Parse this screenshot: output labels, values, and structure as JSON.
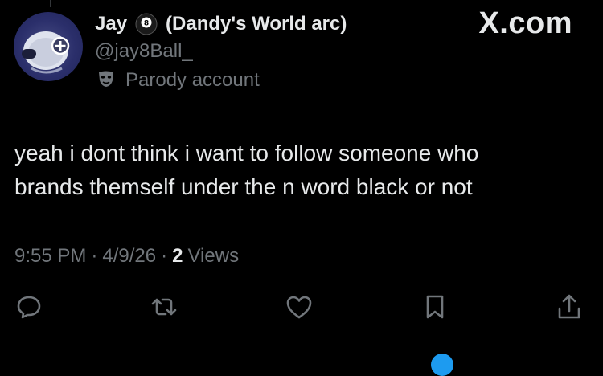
{
  "header": {
    "display_name": "Jay",
    "name_suffix": "(Dandy's World arc)",
    "handle": "@jay8Ball_",
    "parody_label": "Parody account",
    "brand": "X.com",
    "name_emoji": "8-ball-icon",
    "avatar_icon": "avatar"
  },
  "tweet": {
    "lines": [
      "yeah i dont think i want to follow someone who",
      "brands themself under the n word black or not"
    ]
  },
  "meta": {
    "time": "9:55 PM",
    "separator": "·",
    "date": "4/9/26",
    "views_count": "2",
    "views_label": "Views"
  },
  "actions": [
    {
      "icon": "reply-icon"
    },
    {
      "icon": "retweet-icon"
    },
    {
      "icon": "like-icon"
    },
    {
      "icon": "bookmark-icon"
    },
    {
      "icon": "share-icon"
    }
  ],
  "colors": {
    "background": "#000000",
    "text_primary": "#e7e9ea",
    "text_secondary": "#71767b",
    "accent": "#1d9bf0"
  }
}
